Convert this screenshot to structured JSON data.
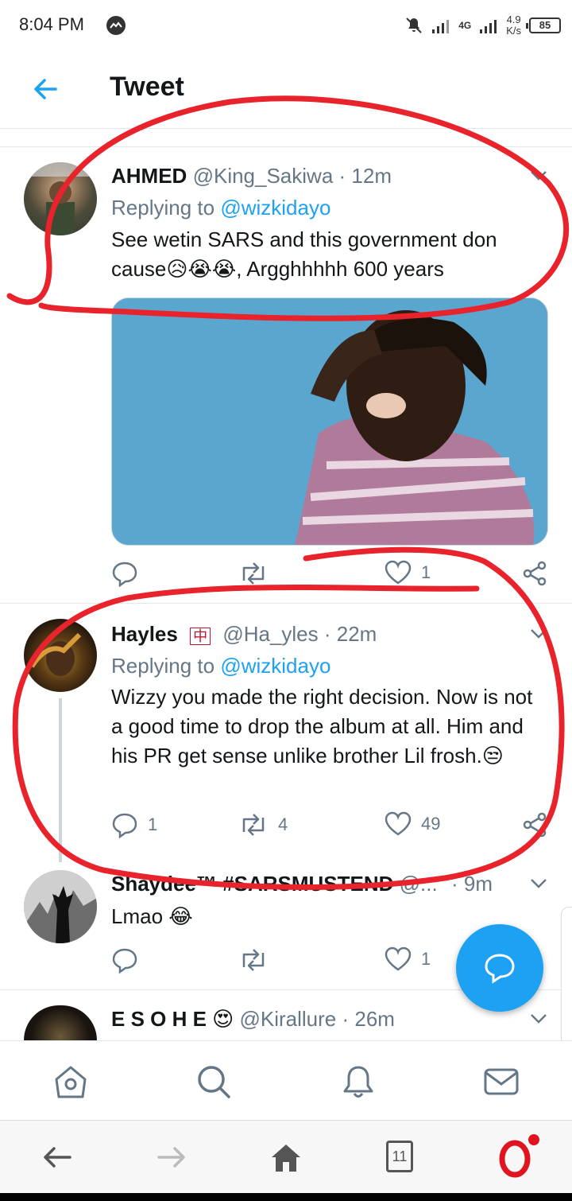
{
  "status_bar": {
    "time": "8:04 PM",
    "network": "4G",
    "speed_value": "4.9",
    "speed_unit": "K/s",
    "battery": "85"
  },
  "header": {
    "title": "Tweet"
  },
  "tweets": [
    {
      "name": "AHMED",
      "handle": "@King_Sakiwa",
      "time": "· 12m",
      "replying_label": "Replying to",
      "replying_to": "@wizkidayo",
      "text_line1": "See wetin SARS and this government don",
      "text_line2": "cause😥😭😭, Argghhhhh 600 years",
      "reply_count": "",
      "retweet_count": "",
      "like_count": "1"
    },
    {
      "name": "Hayles",
      "badge": "中",
      "handle": "@Ha_yles",
      "time": "· 22m",
      "replying_label": "Replying to",
      "replying_to": "@wizkidayo",
      "text": "Wizzy you made the right decision. Now is not a good time to drop the album at all. Him and his PR get sense unlike brother Lil frosh.😒",
      "reply_count": "1",
      "retweet_count": "4",
      "like_count": "49"
    },
    {
      "name": "Shaydee™ #SARSMUSTEND",
      "handle": "@...",
      "time": "· 9m",
      "text": "Lmao 😂",
      "reply_count": "",
      "retweet_count": "",
      "like_count": "1"
    },
    {
      "name": "E S O H E 😍",
      "handle": "@Kirallure",
      "time": "· 26m"
    }
  ],
  "browser": {
    "tab_count": "11"
  },
  "colors": {
    "accent": "#1da1f2",
    "annotation": "#e8232b",
    "opera": "#e0141e"
  },
  "icons": [
    "back-arrow-icon",
    "chevron-down-icon",
    "reply-icon",
    "retweet-icon",
    "like-icon",
    "share-icon",
    "compose-icon",
    "home-icon",
    "search-icon",
    "notifications-icon",
    "messages-icon"
  ]
}
